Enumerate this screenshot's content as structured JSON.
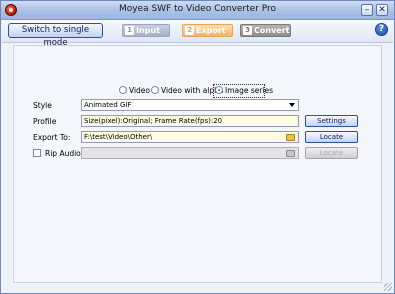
{
  "window": {
    "title": "Moyea SWF to Video Converter Pro",
    "minimize_glyph": "–",
    "close_glyph": "✕"
  },
  "toolbar": {
    "single_mode_label": "Switch to single mode",
    "steps": [
      {
        "number": "1",
        "label": "Input",
        "state": "normal"
      },
      {
        "number": "2",
        "label": "Export",
        "state": "active"
      },
      {
        "number": "3",
        "label": "Convert",
        "state": "disabled"
      }
    ],
    "help_glyph": "?"
  },
  "output_type": {
    "options": [
      "Video",
      "Video with alpha",
      "Image series"
    ],
    "selected": "Image series"
  },
  "form": {
    "style_label": "Style",
    "style_value": "Animated GIF",
    "profile_label": "Profile",
    "profile_value": "Size(pixel):Original; Frame Rate(fps):20",
    "export_label": "Export To:",
    "export_value": "F:\\test\\Video\\Other\\",
    "rip_audio_label": "Rip Audio:",
    "rip_audio_checked": false,
    "rip_audio_value": ""
  },
  "buttons": {
    "settings": "Settings",
    "locate": "Locate",
    "locate_disabled": "Locate"
  },
  "colors": {
    "accent": "#2e4f9b",
    "active_step": "#f3b56c",
    "title_bar": "#aac0e6"
  },
  "icons": [
    "app-logo-icon",
    "minimize-icon",
    "close-icon",
    "help-icon",
    "dropdown-arrow-icon",
    "folder-icon"
  ]
}
